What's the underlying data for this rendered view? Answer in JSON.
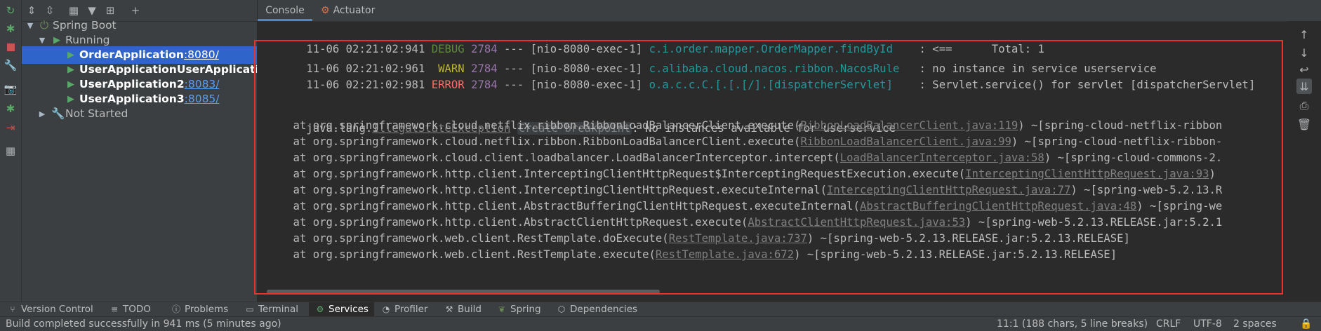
{
  "tree": {
    "root": "Spring Boot",
    "running": "Running",
    "apps": [
      {
        "name": "OrderApplication",
        "port": ":8080/"
      },
      {
        "name": "UserApplicationUserApplication",
        "port": ""
      },
      {
        "name": "UserApplication2",
        "port": ":8083/"
      },
      {
        "name": "UserApplication3",
        "port": ":8085/"
      }
    ],
    "not_started": "Not Started"
  },
  "tabs": {
    "console": "Console",
    "actuator": "Actuator"
  },
  "console": {
    "line0": {
      "date": "11-06 02:21:02:941",
      "level": "DEBUG",
      "pid": "2784",
      "sep": "---",
      "thread": "[nio-8080-exec-1]",
      "logger": "c.i.order.mapper.OrderMapper.findById",
      "msg": ": <==      Total: 1"
    },
    "line1": {
      "date": "11-06 02:21:02:961",
      "level": "WARN",
      "pid": "2784",
      "sep": "---",
      "thread": "[nio-8080-exec-1]",
      "logger": "c.alibaba.cloud.nacos.ribbon.NacosRule",
      "msg": ": no instance in service userservice"
    },
    "line2": {
      "date": "11-06 02:21:02:981",
      "level": "ERROR",
      "pid": "2784",
      "sep": "---",
      "thread": "[nio-8080-exec-1]",
      "logger": "o.a.c.c.C.[.[.[/].[dispatcherServlet]",
      "msg": ": Servlet.service() for servlet [dispatcherServlet]"
    },
    "exception": {
      "prefix": "java.lang.",
      "name": "IllegalStateException",
      "breakpoint": "Create breakpoint",
      "msg": ": No instances available for userservice"
    },
    "stack": [
      {
        "pre": "    at org.springframework.cloud.netflix.ribbon.RibbonLoadBalancerClient.execute(",
        "link": "RibbonLoadBalancerClient.java:119",
        "post": ") ~[spring-cloud-netflix-ribbon"
      },
      {
        "pre": "    at org.springframework.cloud.netflix.ribbon.RibbonLoadBalancerClient.execute(",
        "link": "RibbonLoadBalancerClient.java:99",
        "post": ") ~[spring-cloud-netflix-ribbon-"
      },
      {
        "pre": "    at org.springframework.cloud.client.loadbalancer.LoadBalancerInterceptor.intercept(",
        "link": "LoadBalancerInterceptor.java:58",
        "post": ") ~[spring-cloud-commons-2."
      },
      {
        "pre": "    at org.springframework.http.client.InterceptingClientHttpRequest$InterceptingRequestExecution.execute(",
        "link": "InterceptingClientHttpRequest.java:93",
        "post": ")"
      },
      {
        "pre": "    at org.springframework.http.client.InterceptingClientHttpRequest.executeInternal(",
        "link": "InterceptingClientHttpRequest.java:77",
        "post": ") ~[spring-web-5.2.13.R"
      },
      {
        "pre": "    at org.springframework.http.client.AbstractBufferingClientHttpRequest.executeInternal(",
        "link": "AbstractBufferingClientHttpRequest.java:48",
        "post": ") ~[spring-we"
      },
      {
        "pre": "    at org.springframework.http.client.AbstractClientHttpRequest.execute(",
        "link": "AbstractClientHttpRequest.java:53",
        "post": ") ~[spring-web-5.2.13.RELEASE.jar:5.2.1"
      },
      {
        "pre": "    at org.springframework.web.client.RestTemplate.doExecute(",
        "link": "RestTemplate.java:737",
        "post": ") ~[spring-web-5.2.13.RELEASE.jar:5.2.13.RELEASE]"
      },
      {
        "pre": "    at org.springframework.web.client.RestTemplate.execute(",
        "link": "RestTemplate.java:672",
        "post": ") ~[spring-web-5.2.13.RELEASE.jar:5.2.13.RELEASE]"
      }
    ]
  },
  "bottom_tabs": [
    {
      "icon": "version-control-icon",
      "label": "Version Control"
    },
    {
      "icon": "todo-icon",
      "label": "TODO"
    },
    {
      "icon": "problems-icon",
      "label": "Problems"
    },
    {
      "icon": "terminal-icon",
      "label": "Terminal"
    },
    {
      "icon": "services-icon",
      "label": "Services"
    },
    {
      "icon": "profiler-icon",
      "label": "Profiler"
    },
    {
      "icon": "build-icon",
      "label": "Build"
    },
    {
      "icon": "spring-icon",
      "label": "Spring"
    },
    {
      "icon": "dependencies-icon",
      "label": "Dependencies"
    }
  ],
  "status": {
    "message": "Build completed successfully in 941 ms (5 minutes ago)",
    "position": "11:1 (188 chars, 5 line breaks)",
    "line_sep": "CRLF",
    "encoding": "UTF-8",
    "indent": "2 spaces"
  },
  "colors": {
    "accent": "#2f65ca",
    "highlight_box": "#e5332e",
    "running_green": "#59a869"
  }
}
